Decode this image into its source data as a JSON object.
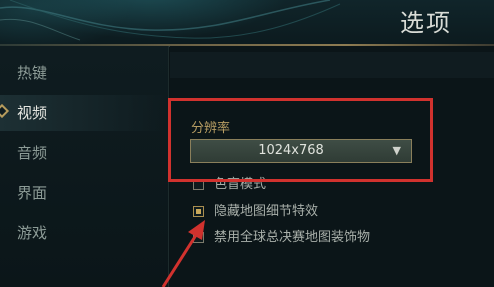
{
  "header": {
    "title": "选项"
  },
  "sidebar": {
    "items": [
      {
        "label": "热键",
        "active": false
      },
      {
        "label": "视频",
        "active": true
      },
      {
        "label": "音频",
        "active": false
      },
      {
        "label": "界面",
        "active": false
      },
      {
        "label": "游戏",
        "active": false
      }
    ]
  },
  "video": {
    "resolution_label": "分辨率",
    "resolution_value": "1024x768",
    "options": [
      {
        "label": "色盲模式",
        "checked": false
      },
      {
        "label": "隐藏地图细节特效",
        "checked": true
      },
      {
        "label": "禁用全球总决赛地图装饰物",
        "checked": false
      }
    ]
  },
  "colors": {
    "highlight": "#d1322e",
    "accent_gold": "#b79d63"
  }
}
